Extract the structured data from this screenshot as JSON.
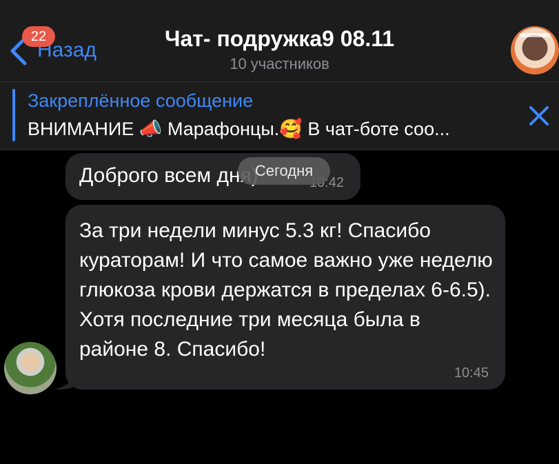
{
  "header": {
    "back_label": "Назад",
    "unread_count": "22",
    "title": "Чат- подружка9 08.11",
    "subtitle": "10 участников",
    "avatar_icon": "group-avatar-icon"
  },
  "pinned": {
    "label": "Закреплённое сообщение",
    "text": "ВНИМАНИЕ 📣 Марафонцы.🥰 В чат-боте соо..."
  },
  "chat": {
    "date_divider": "Сегодня",
    "messages": [
      {
        "text": "Доброго всем дня)",
        "time": "10:42"
      },
      {
        "text": "За три недели минус 5.3 кг! Спасибо кураторам! И что самое важно уже неделю глюкоза  крови держатся в пределах 6-6.5). Хотя последние три месяца была в районе 8. Спасибо!",
        "time": "10:45"
      }
    ]
  },
  "colors": {
    "accent": "#3e88f7",
    "badge": "#e8594a",
    "bubble": "#262628",
    "header": "#1c1c1d"
  }
}
